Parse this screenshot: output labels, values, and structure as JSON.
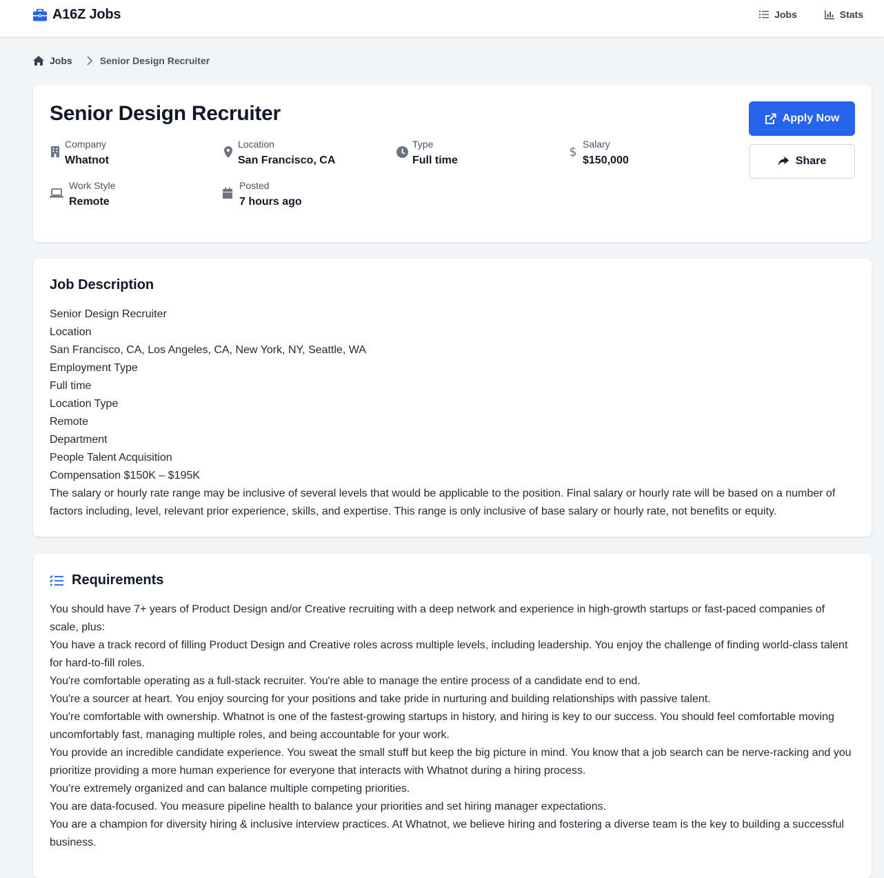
{
  "topbar": {
    "brand": "A16Z Jobs",
    "nav": [
      {
        "label": "Jobs",
        "icon": "list-icon"
      },
      {
        "label": "Stats",
        "icon": "bar-chart-icon"
      }
    ]
  },
  "breadcrumb": {
    "home_label": "Jobs",
    "current": "Senior Design Recruiter"
  },
  "job": {
    "title": "Senior Design Recruiter",
    "meta": {
      "company": {
        "label": "Company",
        "value": "Whatnot"
      },
      "location": {
        "label": "Location",
        "value": "San Francisco, CA"
      },
      "type": {
        "label": "Type",
        "value": "Full time"
      },
      "salary": {
        "label": "Salary",
        "value": "$150,000"
      },
      "work_style": {
        "label": "Work Style",
        "value": "Remote"
      },
      "posted": {
        "label": "Posted",
        "value": "7 hours ago"
      }
    },
    "apply_label": "Apply Now",
    "share_label": "Share"
  },
  "description": {
    "title": "Job Description",
    "lines": [
      "Senior Design Recruiter",
      "Location",
      "San Francisco, CA, Los Angeles, CA, New York, NY, Seattle, WA",
      "Employment Type",
      "Full time",
      "Location Type",
      "Remote",
      "Department",
      "People Talent Acquisition",
      "Compensation $150K – $195K",
      "The salary or hourly rate range may be inclusive of several levels that would be applicable to the position. Final salary or hourly rate will be based on a number of factors including, level, relevant prior experience, skills, and expertise. This range is only inclusive of base salary or hourly rate, not benefits or equity."
    ]
  },
  "requirements": {
    "title": "Requirements",
    "lines": [
      "You should have 7+ years of Product Design and/or Creative recruiting with a deep network and experience in high-growth startups or fast-paced companies of scale, plus:",
      "You have a track record of filling Product Design and Creative roles across multiple levels, including leadership. You enjoy the challenge of finding world-class talent for hard-to-fill roles.",
      "You're comfortable operating as a full-stack recruiter. You're able to manage the entire process of a candidate end to end.",
      "You're a sourcer at heart. You enjoy sourcing for your positions and take pride in nurturing and building relationships with passive talent.",
      "You're comfortable with ownership. Whatnot is one of the fastest-growing startups in history, and hiring is key to our success. You should feel comfortable moving uncomfortably fast, managing multiple roles, and being accountable for your work.",
      "You provide an incredible candidate experience. You sweat the small stuff but keep the big picture in mind. You know that a job search can be nerve-racking and you prioritize providing a more human experience for everyone that interacts with Whatnot during a hiring process.",
      "You’re extremely organized and can balance multiple competing priorities.",
      "You are data-focused. You measure pipeline health to balance your priorities and set hiring manager expectations.",
      "You are a champion for diversity hiring & inclusive interview practices. At Whatnot, we believe hiring and fostering a diverse team is the key to building a successful business."
    ]
  },
  "colors": {
    "accent": "#2563eb",
    "background": "#f3f4f6",
    "card": "#ffffff",
    "icon_gray": "#6b7280"
  }
}
